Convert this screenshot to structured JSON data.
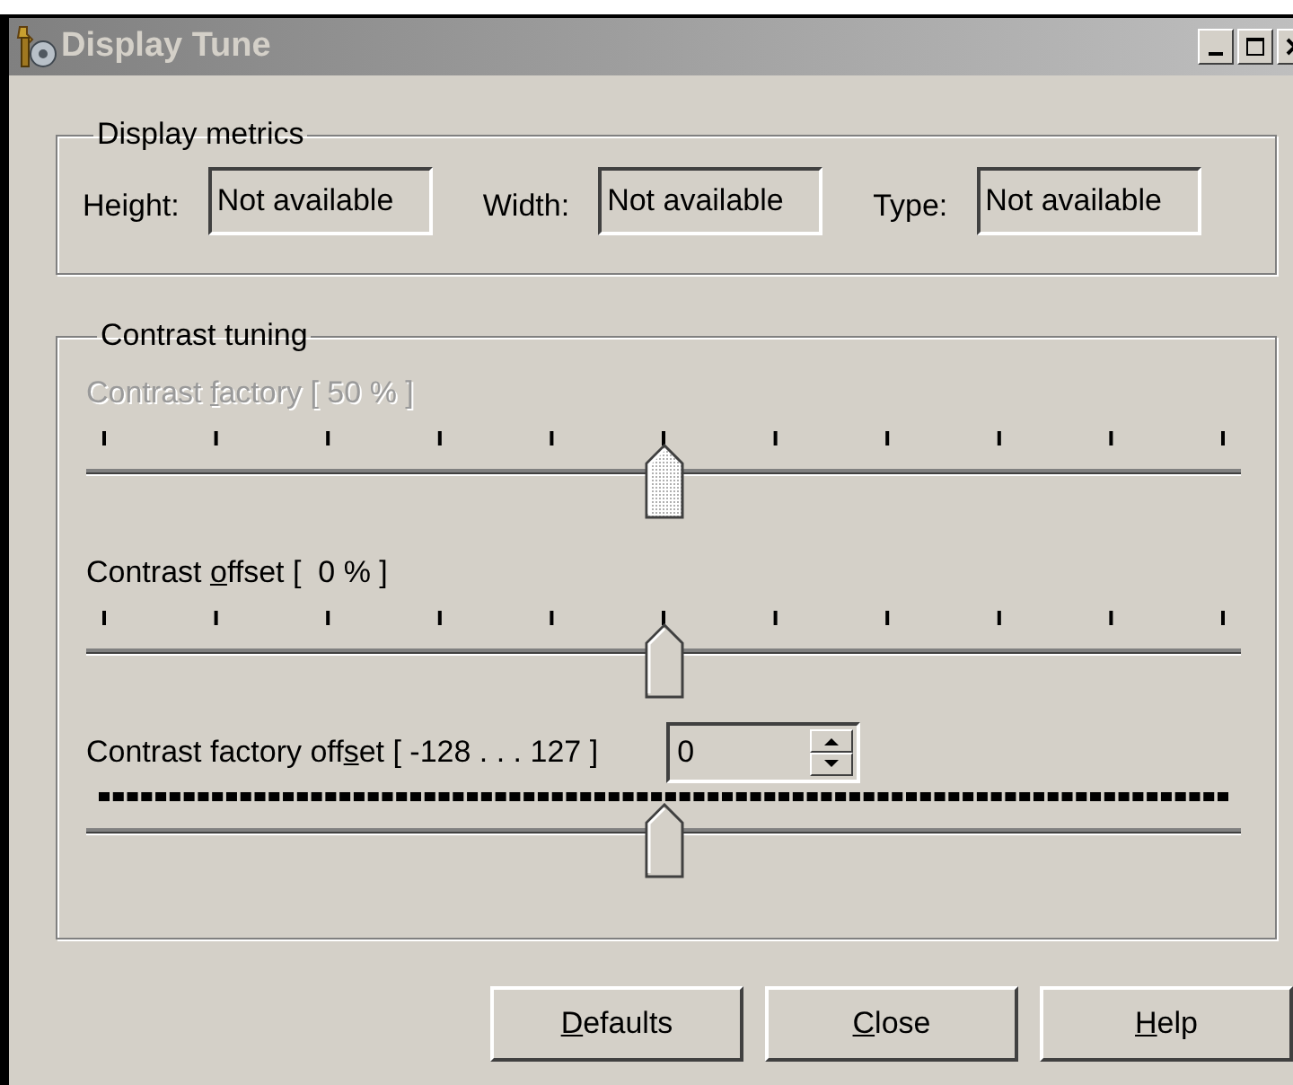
{
  "window": {
    "title": "Display Tune"
  },
  "metrics": {
    "title": "Display metrics",
    "fields": [
      {
        "label": "Height:",
        "value": "Not available"
      },
      {
        "label": "Width:",
        "value": "Not available"
      },
      {
        "label": "Type:",
        "value": "Not available"
      }
    ]
  },
  "contrast": {
    "title": "Contrast tuning",
    "sliders": [
      {
        "label": {
          "before": "Contrast ",
          "key": "f",
          "after": "actory [ 50 % ]"
        },
        "disabled": true,
        "level": 0.5,
        "fine_ticks": false
      },
      {
        "label": {
          "before": "Contrast ",
          "key": "o",
          "after": "ffset [  0 % ]"
        },
        "disabled": false,
        "level": 0.5,
        "fine_ticks": false
      },
      {
        "label": {
          "before": "Contrast factory off",
          "key": "s",
          "after": "et [ -128 . . . 127 ]"
        },
        "disabled": false,
        "level": 0.5,
        "fine_ticks": true,
        "spinner": {
          "value": "0"
        }
      }
    ]
  },
  "buttons": [
    {
      "key": "D",
      "after": "efaults"
    },
    {
      "key": "C",
      "after": "lose"
    },
    {
      "key": "H",
      "after": "elp"
    }
  ]
}
